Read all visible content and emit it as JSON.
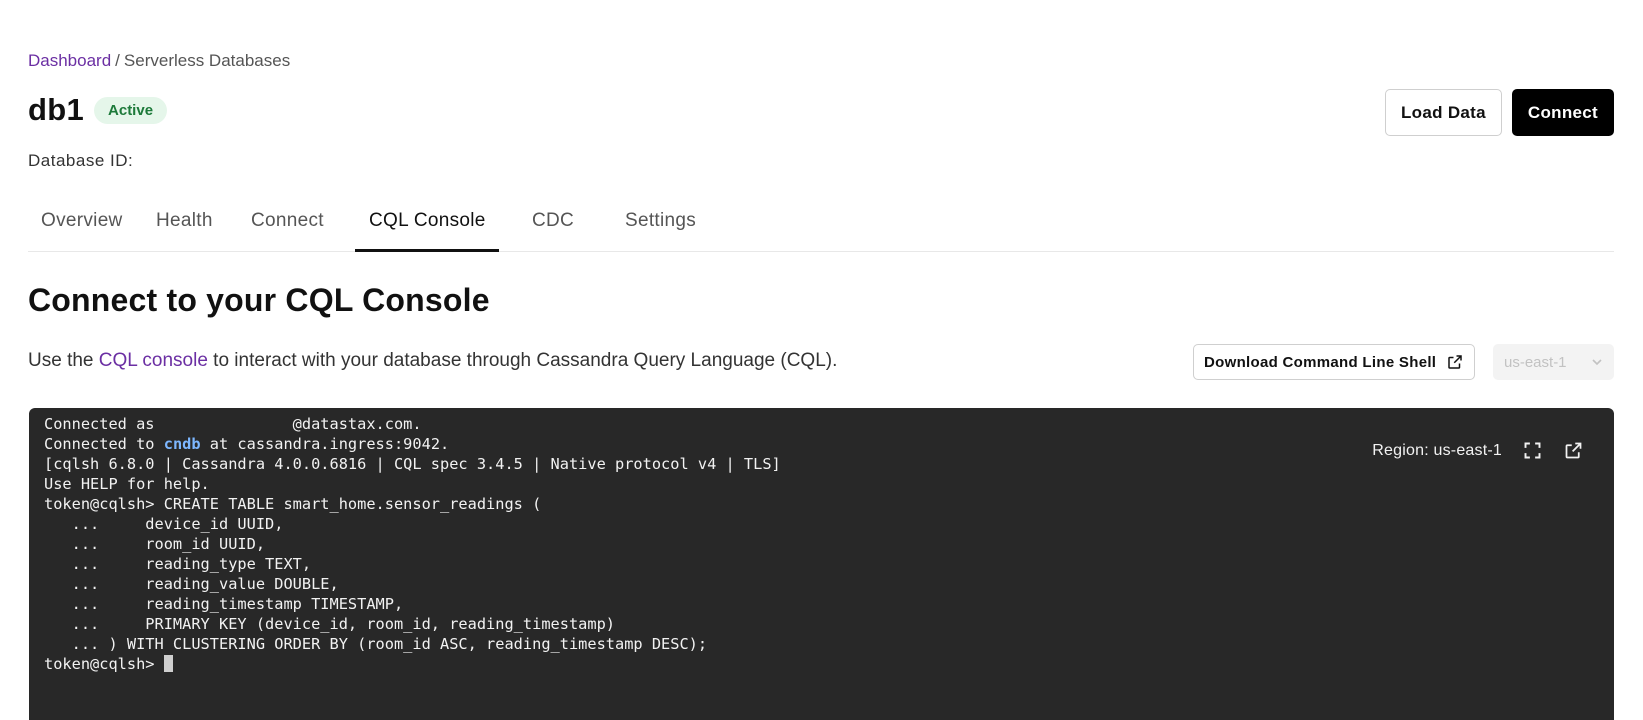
{
  "breadcrumb": {
    "root": "Dashboard",
    "separator": "/",
    "current": "Serverless Databases"
  },
  "database": {
    "name": "db1",
    "status": "Active",
    "id_label": "Database ID:"
  },
  "actions": {
    "load_data": "Load Data",
    "connect": "Connect"
  },
  "tabs": [
    {
      "label": "Overview"
    },
    {
      "label": "Health"
    },
    {
      "label": "Connect"
    },
    {
      "label": "CQL Console",
      "active": true
    },
    {
      "label": "CDC"
    },
    {
      "label": "Settings"
    }
  ],
  "section": {
    "title": "Connect to your CQL Console",
    "intro_prefix": "Use the ",
    "intro_link": "CQL console",
    "intro_suffix": " to interact with your database through Cassandra Query Language (CQL).",
    "download_button": "Download Command Line Shell",
    "region_select": "us-east-1"
  },
  "console": {
    "region_label": "Region: us-east-1",
    "lines": {
      "l1": "Connected as               @datastax.com.",
      "l2_prefix": "Connected to ",
      "l2_keyword": "cndb",
      "l2_suffix": " at cassandra.ingress:9042.",
      "l3": "[cqlsh 6.8.0 | Cassandra 4.0.0.6816 | CQL spec 3.4.5 | Native protocol v4 | TLS]",
      "l4": "Use HELP for help.",
      "l5": "token@cqlsh> CREATE TABLE smart_home.sensor_readings (",
      "l6": "   ...     device_id UUID,",
      "l7": "   ...     room_id UUID,",
      "l8": "   ...     reading_type TEXT,",
      "l9": "   ...     reading_value DOUBLE,",
      "l10": "   ...     reading_timestamp TIMESTAMP,",
      "l11": "   ...     PRIMARY KEY (device_id, room_id, reading_timestamp)",
      "l12": "   ... ) WITH CLUSTERING ORDER BY (room_id ASC, reading_timestamp DESC);",
      "prompt": "token@cqlsh> "
    }
  },
  "colors": {
    "accent_link": "#6b2fa3",
    "status_bg": "#e5f6ea",
    "status_text": "#1d7a3a",
    "console_bg": "#282828",
    "console_keyword": "#7db7ff"
  },
  "icons": {
    "download_external": "external-link-icon",
    "region_chevron": "chevron-down-icon",
    "fullscreen": "fullscreen-icon",
    "popout": "external-link-icon"
  }
}
